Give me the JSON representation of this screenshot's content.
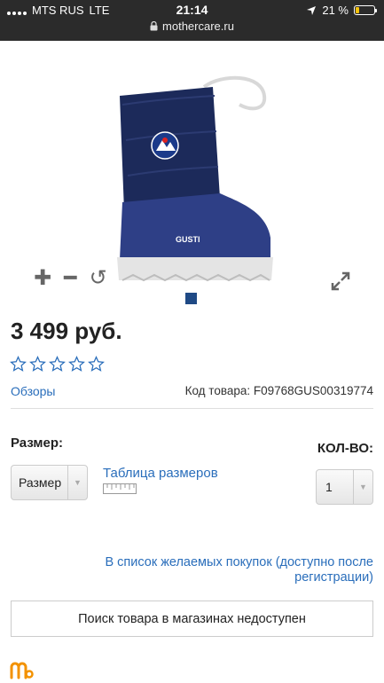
{
  "status_bar": {
    "carrier": "MTS RUS",
    "network": "LTE",
    "time": "21:14",
    "battery": "21 %",
    "battery_level": 0.21,
    "url": "mothercare.ru"
  },
  "product": {
    "price": "3 499 руб.",
    "rating": 0,
    "reviews_link": "Обзоры",
    "sku": "Код товара: F09768GUS00319774",
    "image_brand": "GUSTI"
  },
  "options": {
    "size_label": "Размер:",
    "size_select_value": "Размер",
    "size_table_link": "Таблица размеров",
    "qty_label": "КОЛ-ВО:",
    "qty_value": "1"
  },
  "actions": {
    "wishlist_link": "В список желаемых покупок (доступно после регистрации)",
    "store_search_button": "Поиск товара в магазинах недоступен"
  },
  "colors": {
    "link": "#2a6ebb",
    "accent_dot": "#1f4a85",
    "logo": "#f39200"
  }
}
